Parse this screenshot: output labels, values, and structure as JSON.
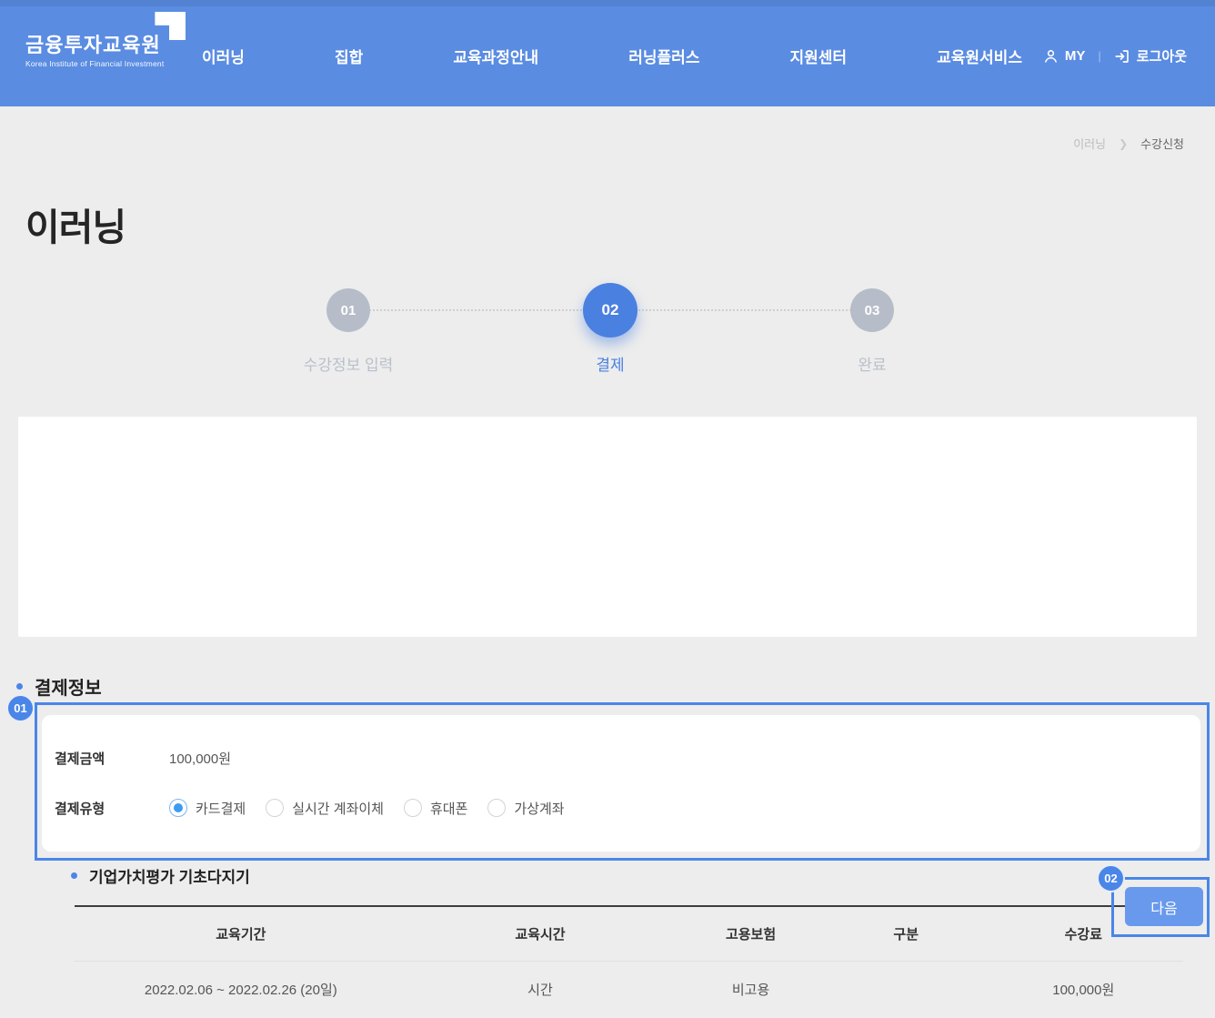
{
  "nav": {
    "logo": {
      "title": "금융투자교육원",
      "subtitle": "Korea Institute of Financial Investment"
    },
    "items": [
      {
        "label": "이러닝"
      },
      {
        "label": "집합"
      },
      {
        "label": "교육과정안내"
      },
      {
        "label": "러닝플러스"
      },
      {
        "label": "지원센터"
      },
      {
        "label": "교육원서비스"
      }
    ],
    "my_label": "MY",
    "logout_label": "로그아웃"
  },
  "breadcrumb": {
    "parent": "이러닝",
    "current": "수강신청"
  },
  "page": {
    "title": "이러닝"
  },
  "stepper": {
    "steps": [
      {
        "num": "01",
        "label": "수강정보 입력",
        "active": false
      },
      {
        "num": "02",
        "label": "결제",
        "active": true
      },
      {
        "num": "03",
        "label": "완료",
        "active": false
      }
    ]
  },
  "course": {
    "title": "기업가치평가 기초다지기",
    "table": {
      "headers": [
        "교육기간",
        "교육시간",
        "고용보험",
        "구분",
        "수강료"
      ],
      "rows": [
        [
          "2022.02.06 ~ 2022.02.26 (20일)",
          "시간",
          "비고용",
          "",
          "100,000원"
        ]
      ]
    }
  },
  "payment": {
    "section_title": "결제정보",
    "amount_label": "결제금액",
    "amount_value": "100,000원",
    "type_label": "결제유형",
    "options": [
      {
        "label": "카드결제",
        "selected": true
      },
      {
        "label": "실시간 계좌이체",
        "selected": false
      },
      {
        "label": "휴대폰",
        "selected": false
      },
      {
        "label": "가상계좌",
        "selected": false
      }
    ]
  },
  "actions": {
    "next_label": "다음"
  },
  "annotations": [
    {
      "num": "01"
    },
    {
      "num": "02"
    }
  ],
  "colors": {
    "nav_blue": "#5a8ce2",
    "accent_blue": "#4a80e0",
    "annotation_blue": "#4a86e8",
    "radio_blue": "#3b9cf2",
    "page_bg": "#ededed"
  }
}
